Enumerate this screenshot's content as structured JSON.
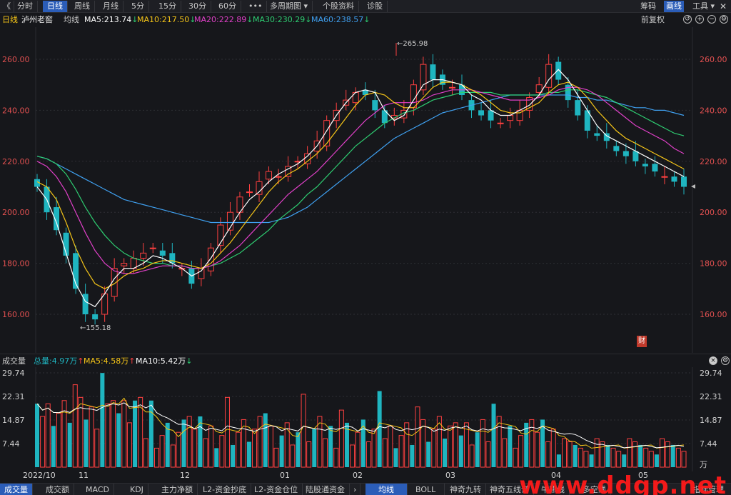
{
  "toolbar": {
    "back": "《",
    "periods": [
      "分时",
      "日线",
      "周线",
      "月线",
      "5分",
      "15分",
      "30分",
      "60分",
      "•••",
      "多周期图 ▾",
      "个股资料",
      "诊股"
    ],
    "active_period": "日线",
    "right": [
      "筹码",
      "画线",
      "工具 ▾"
    ],
    "right_active": "画线"
  },
  "info": {
    "period": "日线",
    "stock": "泸州老窖",
    "line_type": "均线",
    "ma5": "MA5:213.74",
    "ma10": "MA10:217.50",
    "ma20": "MA20:222.89",
    "ma30": "MA30:230.29",
    "ma60": "MA60:238.57",
    "ma_arrow": "↓",
    "adjust": "前复权"
  },
  "colors": {
    "up": "#ff4040",
    "down": "#1fb5c0",
    "ma5": "#ffffff",
    "ma10": "#f5c518",
    "ma20": "#e040c8",
    "ma30": "#2ecc71",
    "ma60": "#3fa0f0"
  },
  "price_axis": [
    "260.00",
    "240.00",
    "220.00",
    "200.00",
    "180.00",
    "160.00"
  ],
  "annotations": {
    "high": "←265.98",
    "low": "←155.18"
  },
  "cai_badge": "财",
  "volume": {
    "title": "成交量",
    "total": "总量:4.97万",
    "ma5": "MA5:4.58万",
    "ma10": "MA10:5.42万",
    "up_arrow": "↑",
    "down_arrow": "↓",
    "axis": [
      "29.74",
      "22.31",
      "14.87",
      "7.44",
      "万"
    ]
  },
  "x_axis": [
    "2022/10",
    "11",
    "12",
    "01",
    "02",
    "03",
    "04",
    "05"
  ],
  "bottom_tabs": [
    "成交量",
    "成交额",
    "MACD",
    "KDJ",
    "主力净额",
    "L2-资金抄底",
    "L2-资金仓位",
    "陆股通资金",
    "›",
    "均线",
    "BOLL",
    "神奇九转",
    "神奇五线谱",
    "牛熊线",
    "多空线",
    "指标管理"
  ],
  "bottom_active": [
    "成交量",
    "均线"
  ],
  "watermark": "www.ddgp.net",
  "chart_data": {
    "type": "candlestick",
    "title": "泸州老窖",
    "ylim": [
      150,
      270
    ],
    "ma5": [
      210,
      205,
      196,
      184,
      172,
      165,
      163,
      168,
      174,
      178,
      178,
      180,
      183,
      182,
      180,
      178,
      175,
      177,
      182,
      188,
      194,
      200,
      205,
      208,
      212,
      215,
      217,
      219,
      222,
      226,
      232,
      238,
      243,
      247,
      248,
      247,
      240,
      236,
      238,
      244,
      250,
      252,
      252,
      251,
      250,
      246,
      244,
      240,
      238,
      238,
      240,
      242,
      246,
      252,
      256,
      252,
      246,
      240,
      234,
      230,
      228,
      226,
      224,
      222,
      220,
      218,
      216,
      214
    ],
    "ma10": [
      212,
      210,
      205,
      196,
      186,
      178,
      172,
      170,
      172,
      175,
      177,
      178,
      180,
      181,
      181,
      180,
      179,
      178,
      180,
      184,
      188,
      193,
      198,
      203,
      208,
      212,
      215,
      217,
      220,
      223,
      227,
      232,
      237,
      242,
      246,
      247,
      246,
      243,
      241,
      241,
      245,
      249,
      251,
      251,
      250,
      248,
      246,
      243,
      240,
      239,
      239,
      241,
      243,
      247,
      250,
      251,
      249,
      245,
      240,
      236,
      232,
      229,
      227,
      225,
      223,
      221,
      219,
      217
    ],
    "ma20": [
      220,
      218,
      214,
      208,
      200,
      192,
      185,
      180,
      177,
      176,
      176,
      177,
      178,
      179,
      179,
      179,
      178,
      178,
      179,
      181,
      184,
      187,
      191,
      195,
      199,
      203,
      207,
      210,
      213,
      216,
      220,
      224,
      228,
      232,
      236,
      239,
      242,
      243,
      243,
      243,
      244,
      246,
      247,
      248,
      248,
      248,
      247,
      246,
      245,
      244,
      244,
      244,
      245,
      246,
      248,
      249,
      249,
      248,
      246,
      243,
      240,
      237,
      234,
      232,
      230,
      228,
      225,
      223
    ],
    "ma30": [
      222,
      221,
      219,
      215,
      209,
      202,
      196,
      191,
      187,
      184,
      182,
      181,
      180,
      180,
      179,
      179,
      178,
      178,
      179,
      180,
      182,
      184,
      187,
      190,
      193,
      197,
      200,
      203,
      207,
      210,
      214,
      218,
      222,
      226,
      229,
      232,
      235,
      237,
      239,
      240,
      242,
      244,
      245,
      246,
      247,
      247,
      247,
      247,
      246,
      246,
      246,
      246,
      246,
      247,
      247,
      248,
      248,
      247,
      246,
      245,
      243,
      241,
      239,
      237,
      235,
      233,
      231,
      230
    ],
    "ma60": [
      222,
      221,
      219,
      217,
      215,
      213,
      211,
      209,
      207,
      205,
      204,
      203,
      202,
      201,
      200,
      199,
      198,
      197,
      196,
      196,
      196,
      196,
      196,
      196,
      196,
      197,
      198,
      200,
      202,
      205,
      208,
      211,
      214,
      217,
      220,
      223,
      226,
      229,
      231,
      233,
      235,
      237,
      239,
      240,
      241,
      242,
      243,
      244,
      245,
      246,
      246,
      246,
      246,
      246,
      246,
      246,
      245,
      245,
      244,
      244,
      243,
      242,
      241,
      241,
      240,
      240,
      239,
      238
    ],
    "close": [
      210,
      200,
      193,
      183,
      170,
      160,
      158,
      168,
      178,
      180,
      182,
      184,
      186,
      183,
      180,
      178,
      172,
      178,
      186,
      195,
      200,
      206,
      208,
      212,
      216,
      214,
      218,
      220,
      223,
      228,
      236,
      240,
      244,
      247,
      246,
      240,
      235,
      238,
      240,
      250,
      258,
      252,
      250,
      249,
      246,
      240,
      238,
      236,
      235,
      238,
      240,
      245,
      250,
      258,
      252,
      244,
      238,
      232,
      230,
      228,
      224,
      222,
      220,
      218,
      216,
      214,
      212,
      210
    ],
    "vol_axis": [
      7.44,
      14.87,
      22.31,
      29.74
    ]
  }
}
